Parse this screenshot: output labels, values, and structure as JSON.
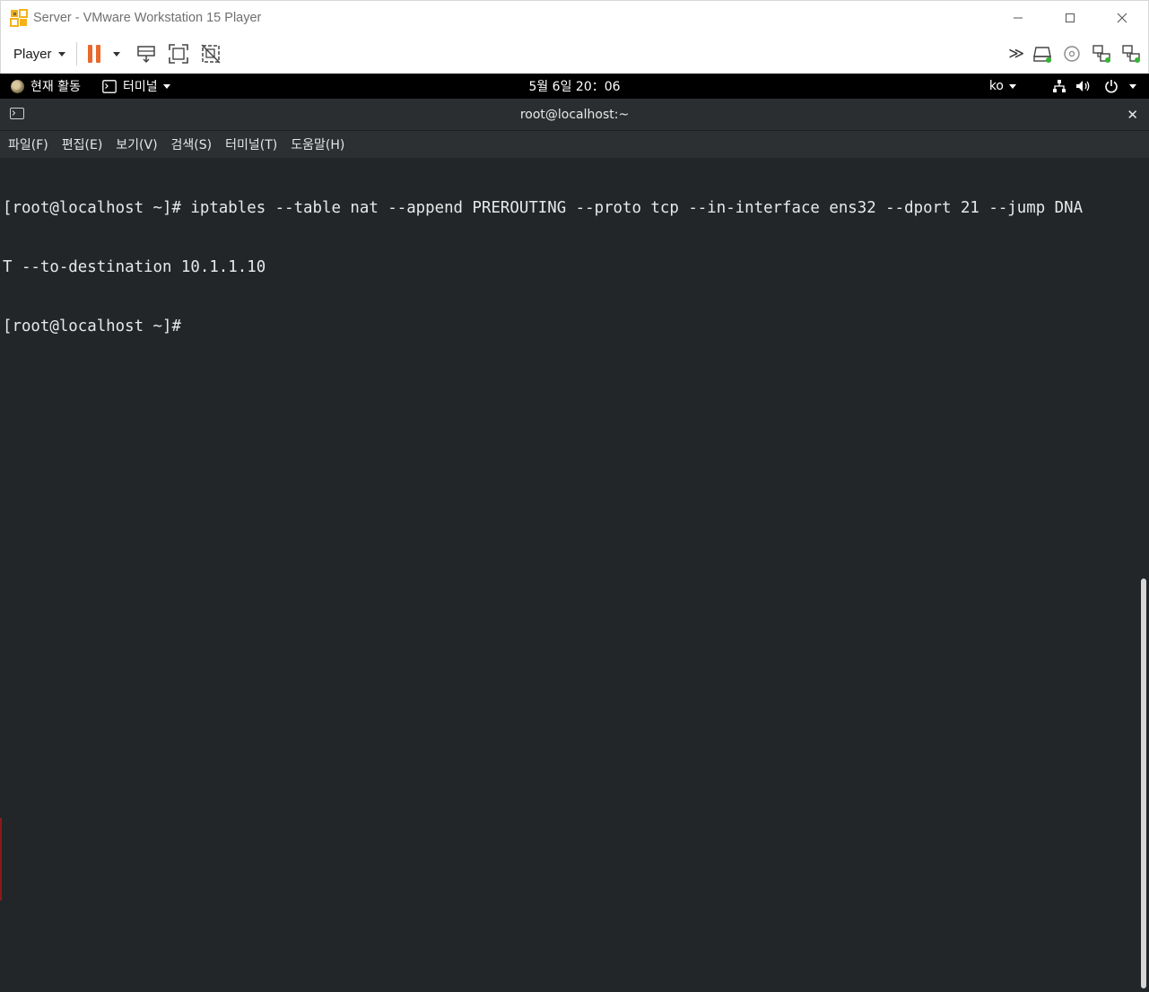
{
  "window": {
    "title": "Server - VMware Workstation 15 Player",
    "controls": [
      "minimize",
      "maximize",
      "close"
    ]
  },
  "toolbar": {
    "player_menu_label": "Player",
    "left_icons": [
      "pause-icon",
      "send-ctrl-alt-del-icon",
      "full-screen-icon",
      "unity-icon"
    ],
    "right_icons": [
      "more-devices-icon",
      "hard-disk-icon",
      "cd-dvd-icon",
      "network-adapter-icon",
      "usb-device-icon"
    ],
    "pause_color": "#e8692b"
  },
  "gnome_bar": {
    "activities_label": "현재 활동",
    "app_menu_label": "터미널",
    "clock": "5월 6일  20：06",
    "language": "ko",
    "status_icons": [
      "network-icon",
      "volume-icon",
      "power-icon"
    ]
  },
  "terminal": {
    "title": "root@localhost:~",
    "menu": [
      "파일(F)",
      "편집(E)",
      "보기(V)",
      "검색(S)",
      "터미널(T)",
      "도움말(H)"
    ],
    "lines": [
      "[root@localhost ~]# iptables --table nat --append PREROUTING --proto tcp --in-interface ens32 --dport 21 --jump DNA",
      "T --to-destination 10.1.1.10",
      "[root@localhost ~]#"
    ],
    "background": "#222629",
    "foreground": "#e8e8e8"
  }
}
